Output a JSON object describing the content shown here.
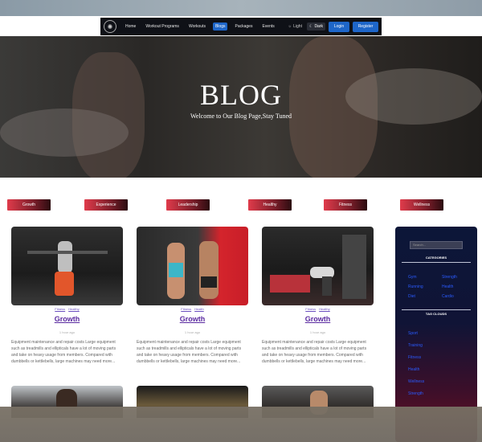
{
  "nav": {
    "links": [
      "Home",
      "Workout Programs",
      "Workouts",
      "Blogs",
      "Packages",
      "Events"
    ],
    "active_index": 3,
    "theme_light": "Light",
    "theme_dark": "Dark",
    "login": "Login",
    "register": "Register"
  },
  "hero": {
    "title": "BLOG",
    "subtitle": "Welcome to Our Blog Page,Stay Tuned"
  },
  "categories": [
    "Growth",
    "Experience",
    "Leadership",
    "Healthy",
    "Fitness",
    "Wellness"
  ],
  "cards": [
    {
      "tags": [
        "Fitness",
        "Healthy"
      ],
      "title": "Growth",
      "time": "1 hour ago",
      "text": "Equipment maintenance and repair costs Large equipment such as treadmills and ellipticals have a lot of moving parts and take on heavy usage from members. Compared with dumbbells or kettlebells, large machines may need more..."
    },
    {
      "tags": [
        "Fitness",
        "Health"
      ],
      "title": "Growth",
      "time": "1 hour ago",
      "text": "Equipment maintenance and repair costs Large equipment such as treadmills and ellipticals have a lot of moving parts and take on heavy usage from members. Compared with dumbbells or kettlebells, large machines may need more..."
    },
    {
      "tags": [
        "Fitness",
        "Healthy"
      ],
      "title": "Growth",
      "time": "1 hour ago",
      "text": "Equipment maintenance and repair costs Large equipment such as treadmills and ellipticals have a lot of moving parts and take on heavy usage from members. Compared with dumbbells or kettlebells, large machines may need more..."
    }
  ],
  "sidebar": {
    "search_placeholder": "Search...",
    "categories_heading": "CATEGORIES",
    "tag_clouds_heading": "TAG CLOUDS",
    "category_links": [
      "Gym",
      "Strength",
      "Running",
      "Health",
      "Diet",
      "Cardio"
    ],
    "tag_links": [
      "Sport",
      "Training",
      "Fitness",
      "Health",
      "Wellness",
      "Strength"
    ]
  },
  "colors": {
    "accent_blue": "#1e66c9",
    "category_red": "#e03b4b",
    "card_title": "#5a2aa0",
    "sidebar_link": "#2a5bff"
  }
}
